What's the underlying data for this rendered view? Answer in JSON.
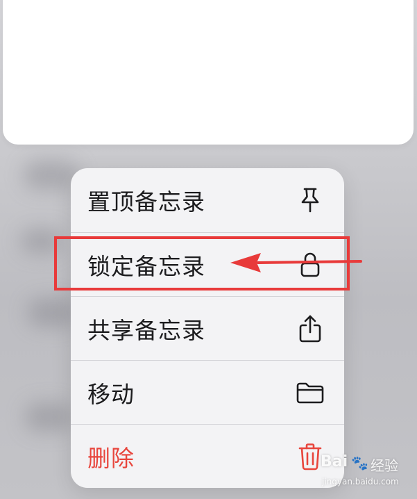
{
  "menu": {
    "items": [
      {
        "label": "置顶备忘录",
        "icon": "pin-icon",
        "destructive": false
      },
      {
        "label": "锁定备忘录",
        "icon": "lock-icon",
        "destructive": false
      },
      {
        "label": "共享备忘录",
        "icon": "share-icon",
        "destructive": false
      },
      {
        "label": "移动",
        "icon": "folder-icon",
        "destructive": false
      },
      {
        "label": "删除",
        "icon": "trash-icon",
        "destructive": true
      }
    ]
  },
  "annotation": {
    "highlight_color": "#e83a3a",
    "highlighted_item": "锁定备忘录"
  },
  "colors": {
    "destructive": "#e8453c",
    "text": "#1c1c1e",
    "menu_background": "#f4f4f6"
  },
  "watermark": {
    "brand": "Bai",
    "brand_cn": "经验",
    "url": "jingyan.baidu.com"
  }
}
